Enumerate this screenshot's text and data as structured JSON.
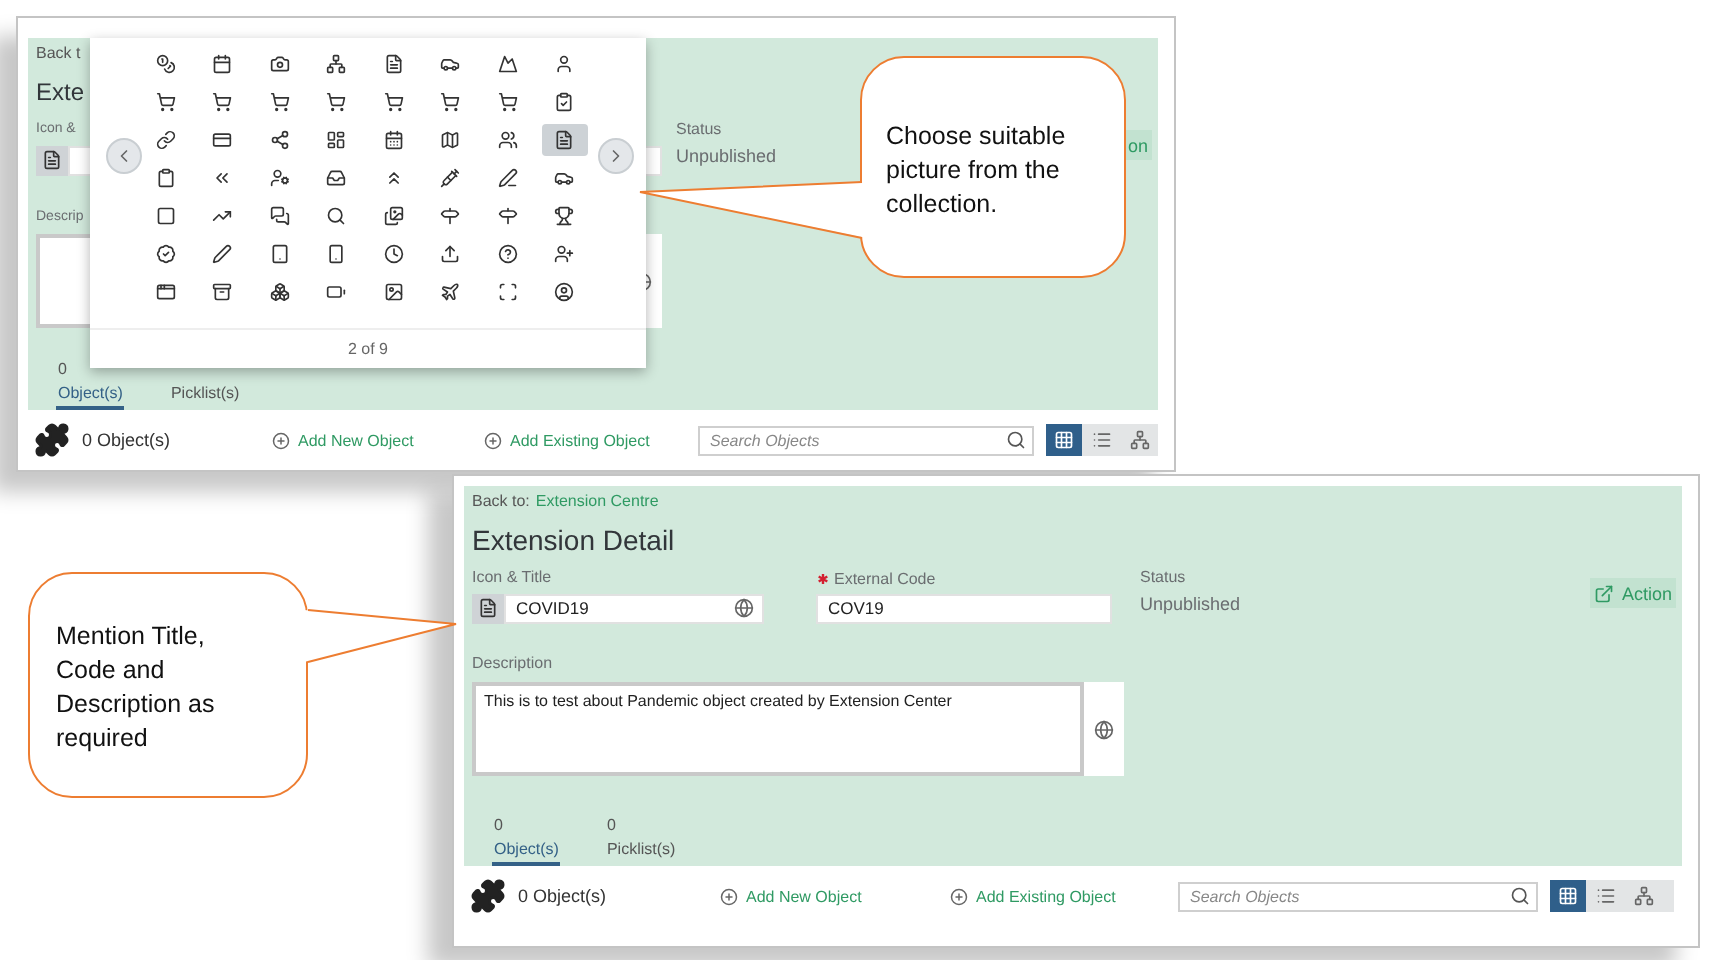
{
  "picker_screen": {
    "back_label": "Back t",
    "title": "Exte",
    "icon_title_label": "Icon &",
    "description_label": "Descrip",
    "status_label": "Status",
    "status": "Unpublished",
    "action_button": "on",
    "tabs": [
      {
        "count": "0",
        "label": "Object(s)",
        "selected": true
      },
      {
        "label": "Picklist(s)",
        "selected": false
      }
    ],
    "toolbar": {
      "count": "0 Object(s)",
      "actions": [
        "Add New Object",
        "Add Existing Object"
      ],
      "search": {
        "placeholder": "Search Objects"
      },
      "views": [
        {
          "kind": "grid",
          "selected": true
        },
        {
          "kind": "list",
          "selected": false
        },
        {
          "kind": "tree",
          "selected": false
        }
      ]
    },
    "icon_picker": {
      "icon_rows": [
        {
          "icons": [
            {
              "selected": false
            },
            {
              "selected": false
            },
            {
              "selected": false
            },
            {
              "selected": false
            },
            {
              "selected": false
            },
            {
              "selected": false
            },
            {
              "selected": false
            },
            {
              "selected": false
            }
          ]
        },
        {
          "icons": [
            {
              "selected": false
            },
            {
              "selected": false
            },
            {
              "selected": false
            },
            {
              "selected": false
            },
            {
              "selected": false
            },
            {
              "selected": false
            },
            {
              "selected": false
            },
            {
              "selected": false
            }
          ]
        },
        {
          "icons": [
            {
              "selected": false
            },
            {
              "selected": false
            },
            {
              "selected": false
            },
            {
              "selected": false
            },
            {
              "selected": false
            },
            {
              "selected": false
            },
            {
              "selected": false
            },
            {
              "selected": true
            }
          ]
        },
        {
          "icons": [
            {
              "selected": false
            },
            {
              "selected": false
            },
            {
              "selected": false
            },
            {
              "selected": false
            },
            {
              "selected": false
            },
            {
              "selected": false
            },
            {
              "selected": false
            },
            {
              "selected": false
            }
          ]
        },
        {
          "icons": [
            {
              "selected": false
            },
            {
              "selected": false
            },
            {
              "selected": false
            },
            {
              "selected": false
            },
            {
              "selected": false
            },
            {
              "selected": false
            },
            {
              "selected": false
            },
            {
              "selected": false
            }
          ]
        },
        {
          "icons": [
            {
              "selected": false
            },
            {
              "selected": false
            },
            {
              "selected": false
            },
            {
              "selected": false
            },
            {
              "selected": false
            },
            {
              "selected": false
            },
            {
              "selected": false
            },
            {
              "selected": false
            }
          ]
        },
        {
          "icons": [
            {
              "selected": false
            },
            {
              "selected": false
            },
            {
              "selected": false
            },
            {
              "selected": false
            },
            {
              "selected": false
            },
            {
              "selected": false
            },
            {
              "selected": false
            },
            {
              "selected": false
            }
          ]
        }
      ],
      "page": "2 of 9"
    }
  },
  "detail_screen": {
    "back_label": "Back to:",
    "back_link": "Extension Centre",
    "title": "Extension Detail",
    "icon_title_label": "Icon & Title",
    "icon_title_value": "COVID19",
    "code_label": "External Code",
    "code_required": true,
    "code_value": "COV19",
    "description_label": "Description",
    "description_value": "This is to test about Pandemic object created by Extension Center",
    "status_label": "Status",
    "status": "Unpublished",
    "action_button": "Action",
    "tabs": [
      {
        "count": "0",
        "label": "Object(s)",
        "selected": true
      },
      {
        "count": "0",
        "label": "Picklist(s)",
        "selected": false
      }
    ],
    "toolbar": {
      "count": "0 Object(s)",
      "actions": [
        "Add New Object",
        "Add Existing Object"
      ],
      "search": {
        "placeholder": "Search Objects"
      },
      "views": [
        {
          "kind": "grid",
          "selected": true
        },
        {
          "kind": "list",
          "selected": false
        },
        {
          "kind": "tree",
          "selected": false
        }
      ]
    }
  },
  "callouts": [
    {
      "text": "Choose suitable picture from the collection."
    },
    {
      "text": "Mention Title, Code and Description as required"
    }
  ]
}
